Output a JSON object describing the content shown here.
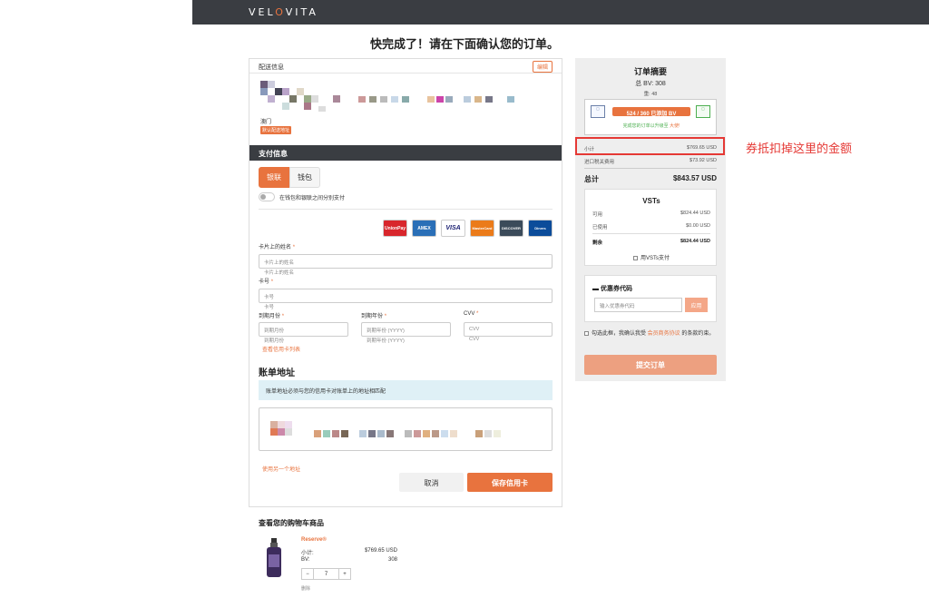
{
  "header": {
    "logo_left": "VEL",
    "logo_o": "O",
    "logo_right": "VITA"
  },
  "page_title": "快完成了！请在下面确认您的订单。",
  "shipping": {
    "title": "配送信息",
    "edit_label": "编辑",
    "city": "澳门",
    "default_tag": "默认配送地址"
  },
  "payment": {
    "title": "支付信息",
    "tabs": [
      "银联",
      "钱包"
    ],
    "split_label": "在钱包和银联之间分别支付",
    "cards": [
      {
        "name": "UnionPay",
        "color": "#d8262c"
      },
      {
        "name": "AMEX",
        "color": "#2a6fb7"
      },
      {
        "name": "VISA",
        "color": "#1a1f71"
      },
      {
        "name": "MasterCard",
        "color": "#eb7b1a"
      },
      {
        "name": "DISCOVER",
        "color": "#3b4b5a"
      },
      {
        "name": "Diners",
        "color": "#0c4c9a"
      }
    ],
    "name_label": "卡片上的姓名",
    "name_placeholder": "卡片上的姓名",
    "number_label": "卡号",
    "number_placeholder": "卡号",
    "month_label": "到期月份",
    "month_placeholder": "到期月份",
    "year_label": "到期年份",
    "year_placeholder": "到期年份 (YYYY)",
    "cvv_label": "CVV",
    "cvv_placeholder": "CVV",
    "view_cards_link": "查看信用卡列表",
    "required_mark": "*"
  },
  "billing": {
    "title": "账单地址",
    "info": "账单地址必须与您的信用卡对账单上的地址相匹配",
    "other_address_link": "使用另一个地址",
    "cancel_label": "取消",
    "save_label": "保存信用卡"
  },
  "cart": {
    "title": "查看您的购物车商品",
    "product_name": "Reserve®",
    "subtotal_label": "小计:",
    "subtotal_value": "$769.65 USD",
    "bv_label": "BV:",
    "bv_value": "308",
    "quantity": "7",
    "minus": "−",
    "plus": "+",
    "remove_label": "删除"
  },
  "summary": {
    "title": "订单摘要",
    "total_bv": "总 BV: 308",
    "weight": "重: 48",
    "bv_progress": "524 / 360 已添加 BV",
    "bv_progress_fraction": 1.0,
    "bv_note_prefix": "完成您的订单以升级至 ",
    "bv_note_suffix": "大使!",
    "subtotal_label": "小计",
    "subtotal_value": "$769.65 USD",
    "import_label": "进口税关费用",
    "import_value": "$73.92 USD",
    "total_label": "总计",
    "total_value": "$843.57 USD",
    "vst": {
      "title": "VSTs",
      "available_label": "可用",
      "available_value": "$824.44 USD",
      "used_label": "已使用",
      "used_value": "$0.00 USD",
      "remaining_label": "剩余",
      "remaining_value": "$824.44 USD",
      "pay_with_label": "用VSTs支付"
    },
    "coupon": {
      "title": "优惠券代码",
      "placeholder": "输入优惠券代码",
      "apply_label": "应用"
    },
    "terms_prefix": "勾选此框，我确认我受 ",
    "terms_link": "会员商务协议",
    "terms_suffix": " 的条款约束。",
    "submit_label": "提交订单"
  },
  "annotation": "券抵扣掉这里的金额",
  "colors": {
    "accent": "#e8733e",
    "header_bg": "#3a3d42",
    "highlight": "#e53935"
  }
}
